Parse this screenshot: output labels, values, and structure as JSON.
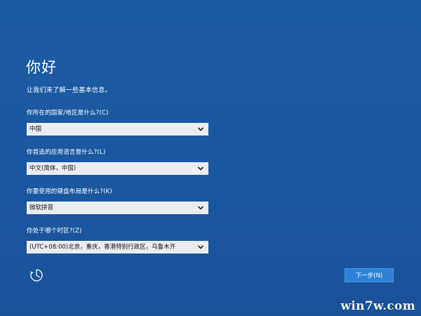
{
  "page": {
    "title": "你好",
    "subtitle": "让我们来了解一些基本信息。"
  },
  "fields": [
    {
      "label": "你所在的国家/地区是什么?(C)",
      "value": "中国"
    },
    {
      "label": "你首选的应用语言是什么?(L)",
      "value": "中文(简体，中国)"
    },
    {
      "label": "你要使用的键盘布局是什么?(K)",
      "value": "微软拼音"
    },
    {
      "label": "你处于哪个时区?(Z)",
      "value": "(UTC+08:00)北京，重庆，香港特别行政区，乌鲁木齐"
    }
  ],
  "actions": {
    "next_label": "下一步(N)"
  },
  "icons": {
    "accessibility": "ease-of-access-icon",
    "dropdown": "chevron-down-icon"
  },
  "watermark": "win7w.com",
  "colors": {
    "background": "#1c5ba3",
    "select_bg": "#ecedf0",
    "button_bg": "#2d82d8"
  }
}
